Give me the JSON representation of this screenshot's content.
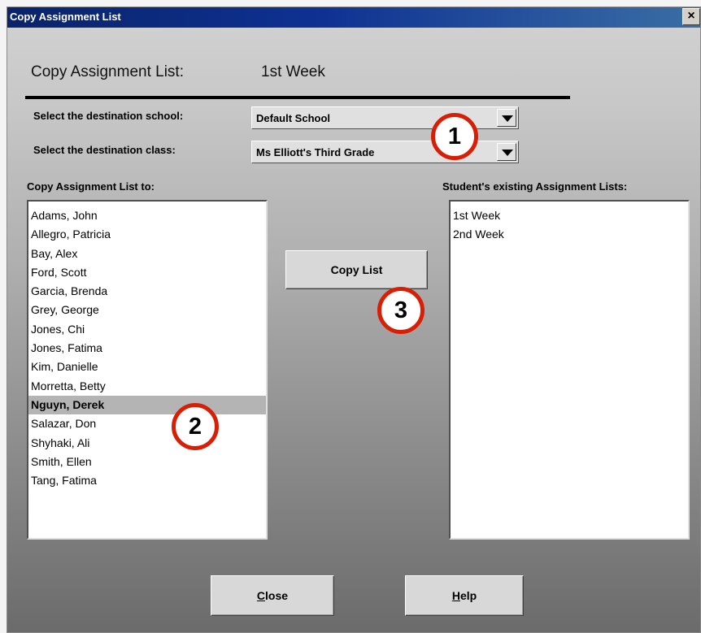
{
  "window": {
    "title": "Copy Assignment List",
    "close_glyph": "×"
  },
  "header": {
    "title": "Copy Assignment List:",
    "list_name": "1st Week"
  },
  "school": {
    "label": "Select the destination school:",
    "value": "Default School"
  },
  "class": {
    "label": "Select the destination class:",
    "value": "Ms Elliott's Third Grade"
  },
  "students": {
    "label": "Copy Assignment List to:",
    "items": [
      "Adams, John",
      "Allegro, Patricia",
      "Bay, Alex",
      "Ford, Scott",
      "Garcia, Brenda",
      "Grey, George",
      "Jones, Chi",
      "Jones, Fatima",
      "Kim, Danielle",
      "Morretta, Betty",
      "Nguyn, Derek",
      "Salazar, Don",
      "Shyhaki, Ali",
      "Smith, Ellen",
      "Tang, Fatima"
    ],
    "selected": "Nguyn, Derek"
  },
  "existing": {
    "label": "Student's existing Assignment Lists:",
    "items": [
      "1st Week",
      "2nd Week"
    ]
  },
  "buttons": {
    "copy": "Copy List",
    "close_mnemonic": "C",
    "close_rest": "lose",
    "help_mnemonic": "H",
    "help_rest": "elp"
  },
  "callouts": [
    "1",
    "2",
    "3"
  ],
  "colors": {
    "callout_ring": "#d81e05",
    "title_bar": "#0a246a",
    "selection": "#b4b4b4"
  }
}
